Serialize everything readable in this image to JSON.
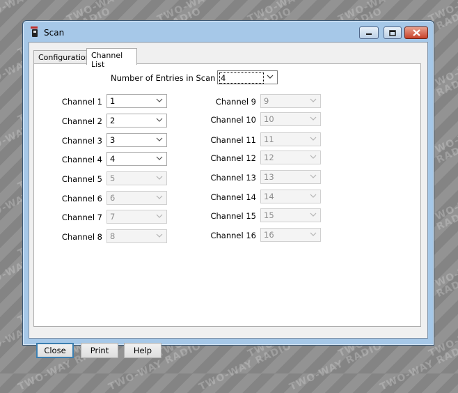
{
  "background": {
    "watermark_text": "TWO-WAY RADIO"
  },
  "window": {
    "title": "Scan",
    "controls": [
      "minimize",
      "maximize",
      "close"
    ]
  },
  "tabs": [
    {
      "label": "Configuration",
      "active": false
    },
    {
      "label": "Channel List",
      "active": true
    }
  ],
  "channel_list": {
    "entries_label": "Number of Entries in Scan List",
    "entries_value": "4",
    "channels": [
      {
        "label": "Channel 1",
        "value": "1",
        "enabled": true
      },
      {
        "label": "Channel 2",
        "value": "2",
        "enabled": true
      },
      {
        "label": "Channel 3",
        "value": "3",
        "enabled": true
      },
      {
        "label": "Channel 4",
        "value": "4",
        "enabled": true
      },
      {
        "label": "Channel 5",
        "value": "5",
        "enabled": false
      },
      {
        "label": "Channel 6",
        "value": "6",
        "enabled": false
      },
      {
        "label": "Channel 7",
        "value": "7",
        "enabled": false
      },
      {
        "label": "Channel 8",
        "value": "8",
        "enabled": false
      },
      {
        "label": "Channel 9",
        "value": "9",
        "enabled": false
      },
      {
        "label": "Channel 10",
        "value": "10",
        "enabled": false
      },
      {
        "label": "Channel 11",
        "value": "11",
        "enabled": false
      },
      {
        "label": "Channel 12",
        "value": "12",
        "enabled": false
      },
      {
        "label": "Channel 13",
        "value": "13",
        "enabled": false
      },
      {
        "label": "Channel 14",
        "value": "14",
        "enabled": false
      },
      {
        "label": "Channel 15",
        "value": "15",
        "enabled": false
      },
      {
        "label": "Channel 16",
        "value": "16",
        "enabled": false
      }
    ]
  },
  "buttons": {
    "close": "Close",
    "print": "Print",
    "help": "Help"
  },
  "colors": {
    "window_frame": "#a6c8e8",
    "close_button": "#c8422b",
    "default_button_border": "#3c7fb1",
    "disabled_text": "#8d8d8d"
  }
}
